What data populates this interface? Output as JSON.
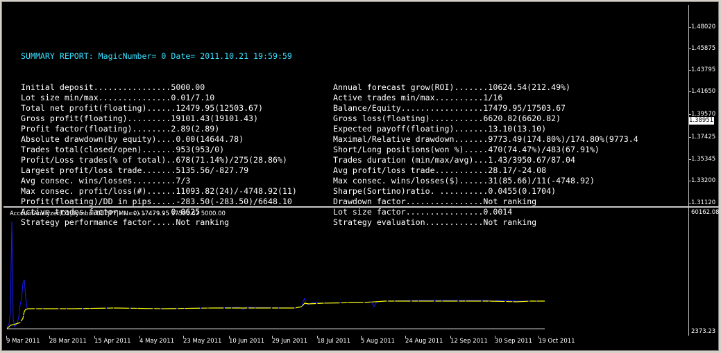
{
  "report": {
    "header": "SUMMARY REPORT: MagicNumber= 0 Date= 2011.10.21 19:59:59",
    "left": [
      "Initial deposit................5000.00",
      "Lot size min/max...............0.01/7.10",
      "Total net profit(floating)......12479.95(12503.67)",
      "Gross profit(floating).........19101.43(19101.43)",
      "Profit factor(floating)........2.89(2.89)",
      "Absolute drawdown(by equity)....0.00(14644.78)",
      "Trades total(closed/open).......953(953/0)",
      "Profit/Loss trades(% of total)..678(71.14%)/275(28.86%)",
      "Largest profit/loss trade.......5135.56/-827.79",
      "Avg consec. wins/losses.........7/3",
      "Max consec. profit/loss(#)......11093.82(24)/-4748.92(11)",
      "Profit(floating)/DD in pips.....-283.50(-283.50)/6648.10",
      "Active trades factor...........0.0625",
      "Strategy performance factor.....Not ranking"
    ],
    "right": [
      "Annual forecast grow(ROI).......10624.54(212.49%)",
      "Active trades min/max..........1/16",
      "Balance/Equity.................17479.95/17503.67",
      "Gross loss(floating)...........6620.82(6620.82)",
      "Expected payoff(floating).......13.10(13.10)",
      "Maximal/Relative drawdown.......9773.49(174.80%)/174.80%(9773.4",
      "Short/Long positions(won %).....470(74.47%)/483(67.91%)",
      "Trades duration (min/max/avg)...1.43/3950.67/87.04",
      "Avg profit/loss trade...........28.17/-24.08",
      "Max consec. wins/losses($)......31(85.66)/11(-4748.92)",
      "Sharpe(Sortino)ratio. ..........0.0455(0.1704)",
      "Drawdown factor................Not ranking",
      "Lot size factor................0.0014",
      "Strategy evaluation............Not ranking"
    ]
  },
  "price_scale": [
    "1.48020",
    "1.45875",
    "1.43795",
    "1.41650",
    "1.39570",
    "1.37425",
    "1.35345",
    "1.33200",
    "1.31120"
  ],
  "current_price": "1.38951",
  "indicator": {
    "title": "AccountAnalyzer(D1|Symbol:GBPJPY|MN=0) 17479.95 17503.67 5000.00",
    "scale_top": "60162.08",
    "scale_bottom": "2373.23"
  },
  "dates": [
    "9 Mar 2011",
    "28 Mar 2011",
    "15 Apr 2011",
    "4 May 2011",
    "23 May 2011",
    "10 Jun 2011",
    "29 Jun 2011",
    "18 Jul 2011",
    "5 Aug 2011",
    "24 Aug 2011",
    "12 Sep 2011",
    "30 Sep 2011",
    "19 Oct 2011"
  ],
  "colors": {
    "background": "#000000",
    "report_text": "#ffffff",
    "report_header": "#38e0ff",
    "equity_line": "#1a1aff",
    "balance_line": "#ffff00",
    "deposit_line": "#c8c8c8"
  }
}
